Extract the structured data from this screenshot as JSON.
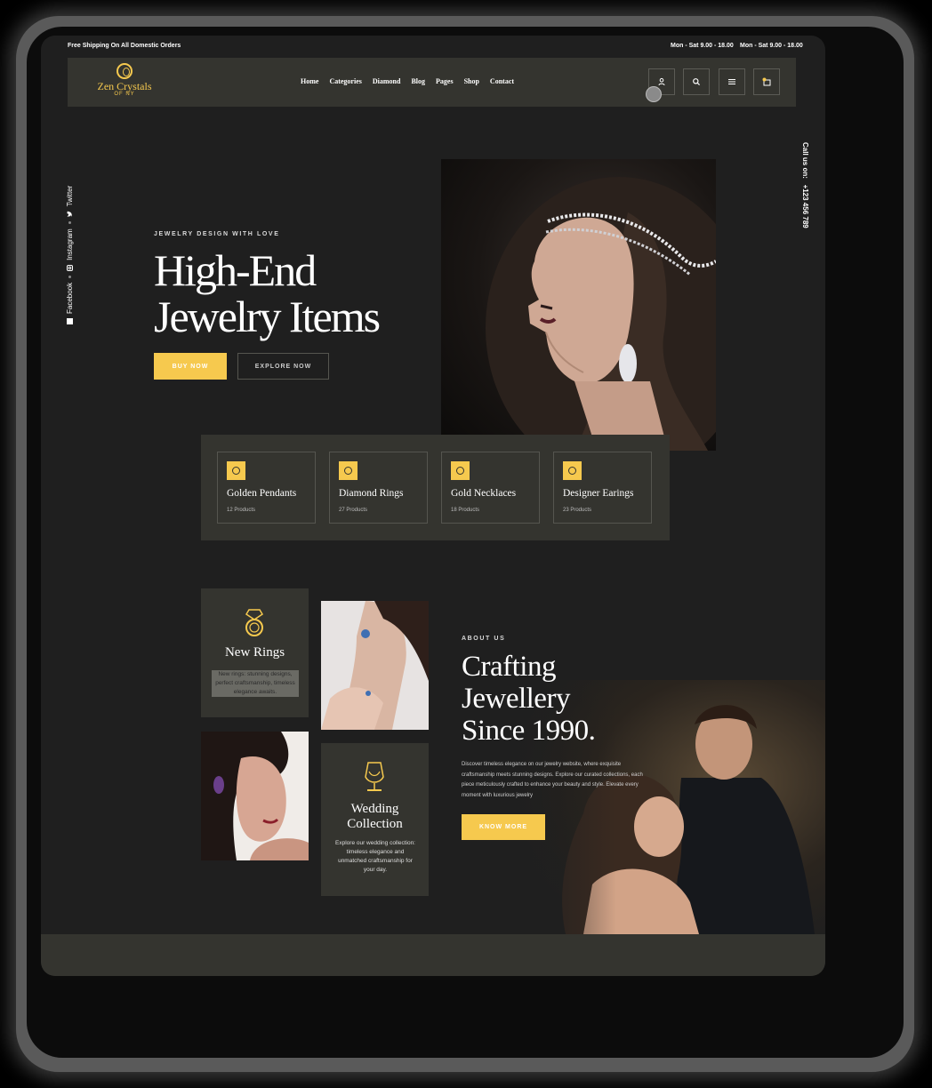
{
  "topbar": {
    "shipping": "Free Shipping On All Domestic Orders",
    "hours_1": "Mon - Sat 9.00 - 18.00",
    "hours_2": "Mon - Sat 9.00 - 18.00"
  },
  "logo": {
    "name": "Zen Crystals",
    "sub": "OF NY"
  },
  "nav": {
    "items": [
      "Home",
      "Categories",
      "Diamond",
      "Blog",
      "Pages",
      "Shop",
      "Contact"
    ],
    "icons": [
      "user-icon",
      "search-icon",
      "menu-icon",
      "cart-icon"
    ]
  },
  "social": {
    "facebook": "Facebook",
    "instagram": "Instagram",
    "twitter": "Twitter"
  },
  "callus": {
    "label": "Call us on:",
    "phone": "+123 456 789"
  },
  "hero": {
    "eyebrow": "JEWELRY DESIGN WITH LOVE",
    "title_line1": "High-End",
    "title_line2": "Jewelry Items",
    "buy_label": "BUY NOW",
    "explore_label": "EXPLORE NOW"
  },
  "categories": [
    {
      "title": "Golden Pendants",
      "count": "12 Products",
      "icon": "pendant-icon"
    },
    {
      "title": "Diamond Rings",
      "count": "27 Products",
      "icon": "ring-icon"
    },
    {
      "title": "Gold Necklaces",
      "count": "18 Products",
      "icon": "necklace-icon"
    },
    {
      "title": "Designer Earings",
      "count": "23 Products",
      "icon": "earring-icon"
    }
  ],
  "tiles": {
    "new_rings": {
      "title": "New Rings",
      "text": "New rings: stunning designs, perfect craftsmanship, timeless elegance awaits."
    },
    "wedding": {
      "title_line1": "Wedding",
      "title_line2": "Collection",
      "text": "Explore our wedding collection: timeless elegance and unmatched craftsmanship for your day."
    }
  },
  "about": {
    "eyebrow": "ABOUT US",
    "title_line1": "Crafting",
    "title_line2": "Jewellery",
    "title_line3": "Since 1990.",
    "text": "Discover timeless elegance on our jewelry website, where exquisite craftsmanship meets stunning designs. Explore our curated collections, each piece meticulously crafted to enhance your beauty and style. Elevate every moment with luxurious jewelry",
    "button_label": "KNOW MORE"
  },
  "colors": {
    "accent": "#f6c94e",
    "background": "#1f1f1f",
    "panel": "#34342f"
  }
}
